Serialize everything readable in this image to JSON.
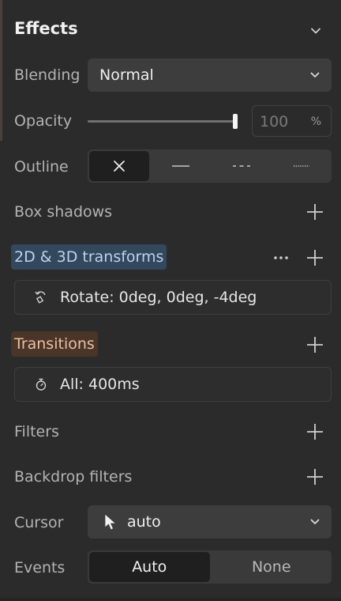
{
  "header": {
    "title": "Effects"
  },
  "blending": {
    "label": "Blending",
    "value": "Normal"
  },
  "opacity": {
    "label": "Opacity",
    "value": "100",
    "unit": "%",
    "level": 1.0
  },
  "outline": {
    "label": "Outline",
    "options": [
      "none",
      "solid",
      "dashed",
      "dotted"
    ],
    "selected": "none"
  },
  "box_shadows": {
    "label": "Box shadows"
  },
  "transforms": {
    "label": "2D & 3D transforms",
    "item": "Rotate: 0deg, 0deg, -4deg"
  },
  "transitions": {
    "label": "Transitions",
    "item": "All: 400ms"
  },
  "filters": {
    "label": "Filters"
  },
  "backdrop_filters": {
    "label": "Backdrop filters"
  },
  "cursor": {
    "label": "Cursor",
    "value": "auto"
  },
  "events": {
    "label": "Events",
    "options": [
      "Auto",
      "None"
    ],
    "selected": "Auto"
  },
  "colors": {
    "panel_bg": "#2b2b2b",
    "transforms_chip": "#33475d",
    "transitions_chip": "#4b3529"
  }
}
